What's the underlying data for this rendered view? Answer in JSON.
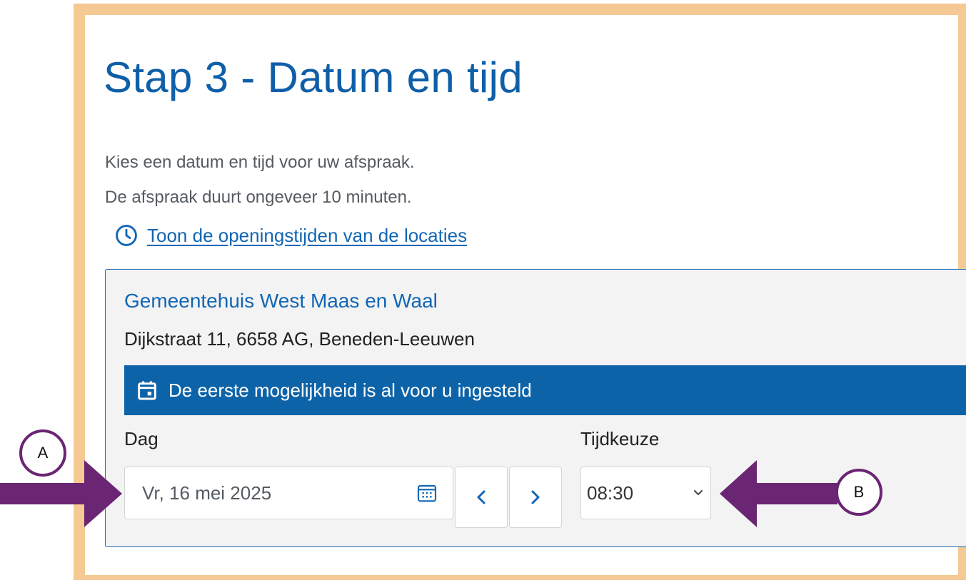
{
  "page": {
    "title": "Stap 3 - Datum en tijd",
    "intro_lines": [
      "Kies een datum en tijd voor uw afspraak.",
      "De afspraak duurt ongeveer 10 minuten."
    ],
    "hours_link": "Toon de openingstijden van de locaties"
  },
  "location": {
    "name": "Gemeentehuis West Maas en Waal",
    "address": "Dijkstraat 11, 6658 AG, Beneden-Leeuwen",
    "banner": "De eerste mogelijkheid is al voor u ingesteld"
  },
  "form": {
    "day_label": "Dag",
    "day_value": "Vr, 16 mei 2025",
    "time_label": "Tijdkeuze",
    "time_value": "08:30"
  },
  "annotations": {
    "marker_a": "A",
    "marker_b": "B"
  },
  "colors": {
    "frame": "#f5c993",
    "primary_blue": "#0d63a8",
    "annotation_purple": "#6a2573"
  }
}
